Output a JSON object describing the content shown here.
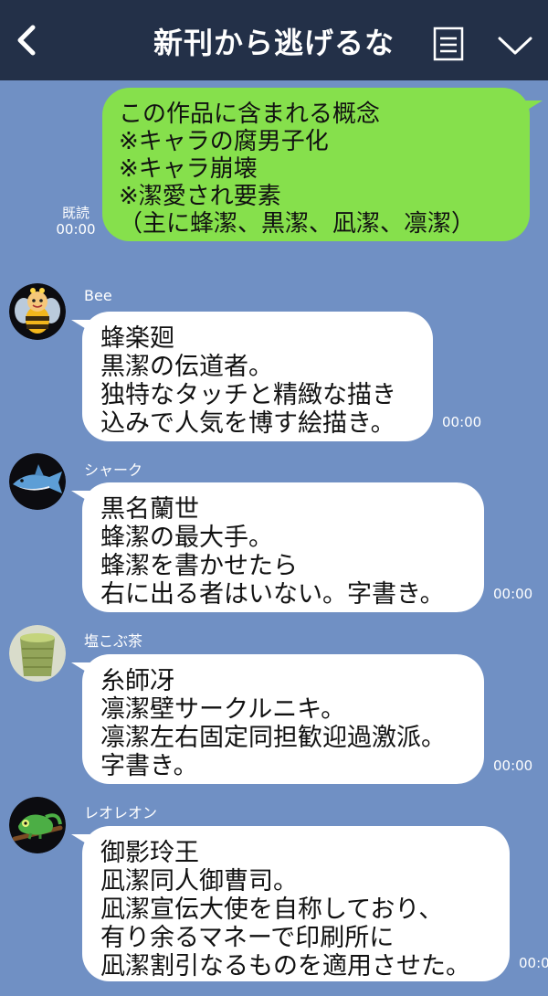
{
  "header": {
    "title": "新刊から逃げるな",
    "back_icon": "back-arrow-icon",
    "menu_icon": "note-menu-icon",
    "expand_icon": "chevron-down-icon"
  },
  "messages": [
    {
      "type": "sent",
      "text": "この作品に含まれる概念\n※キャラの腐男子化\n※キャラ崩壊\n※潔愛され要素\n（主に蜂潔、黒潔、凪潔、凛潔）",
      "read": "既読",
      "time": "00:00"
    },
    {
      "type": "recv",
      "sender": "Bee",
      "avatar_icon": "bee-avatar-icon",
      "text": "蜂楽廻\n黒潔の伝道者。\n独特なタッチと精緻な描き\n込みで人気を博す絵描き。",
      "time": "00:00"
    },
    {
      "type": "recv",
      "sender": "シャーク",
      "avatar_icon": "shark-avatar-icon",
      "text": "黒名蘭世\n蜂潔の最大手。\n蜂潔を書かせたら\n右に出る者はいない。字書き。",
      "time": "00:00"
    },
    {
      "type": "recv",
      "sender": "塩こぶ茶",
      "avatar_icon": "tea-cup-avatar-icon",
      "text": "糸師冴\n凛潔壁サークルニキ。\n凛潔左右固定同担歓迎過激派。\n字書き。",
      "time": "00:00"
    },
    {
      "type": "recv",
      "sender": "レオレオン",
      "avatar_icon": "chameleon-avatar-icon",
      "text": "御影玲王\n凪潔同人御曹司。\n凪潔宣伝大使を自称しており、\n有り余るマネーで印刷所に\n凪潔割引なるものを適用させた。",
      "time": "00:0"
    }
  ]
}
